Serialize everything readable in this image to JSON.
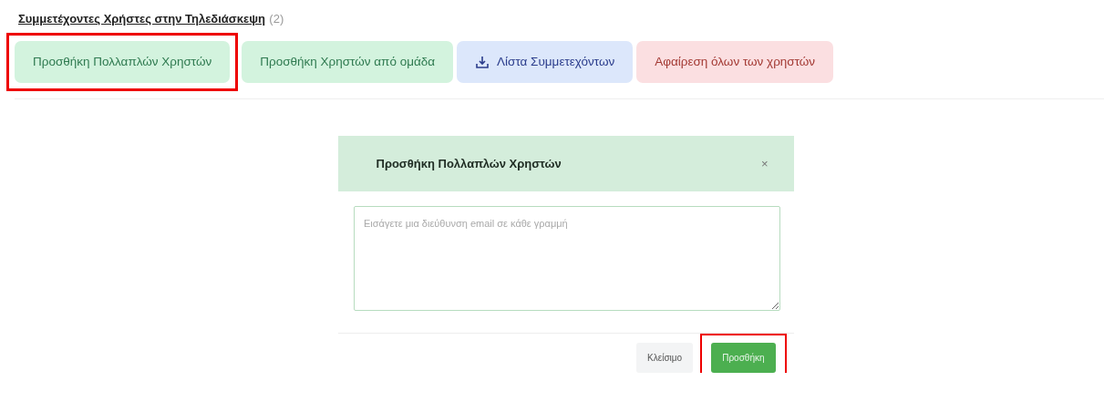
{
  "section": {
    "title": "Συμμετέχοντες Χρήστες στην Τηλεδιάσκεψη",
    "count": "(2)"
  },
  "actions": [
    {
      "label": "Προσθήκη Πολλαπλών Χρηστών",
      "kind": "success",
      "highlighted": true
    },
    {
      "label": "Προσθήκη Χρηστών από ομάδα",
      "kind": "success",
      "highlighted": false
    },
    {
      "label": "Λίστα Συμμετεχόντων",
      "kind": "info",
      "highlighted": false
    },
    {
      "label": "Αφαίρεση όλων των χρηστών",
      "kind": "danger",
      "highlighted": false
    }
  ],
  "dialog": {
    "title": "Προσθήκη Πολλαπλών Χρηστών",
    "close": "×",
    "textarea": {
      "placeholder": "Εισάγετε μια διεύθυνση email σε κάθε γραμμή"
    },
    "buttons": [
      {
        "label": "Κλείσιμο",
        "kind": "secondary",
        "highlighted": false
      },
      {
        "label": "Προσθήκη",
        "kind": "primary",
        "highlighted": true
      }
    ]
  }
}
